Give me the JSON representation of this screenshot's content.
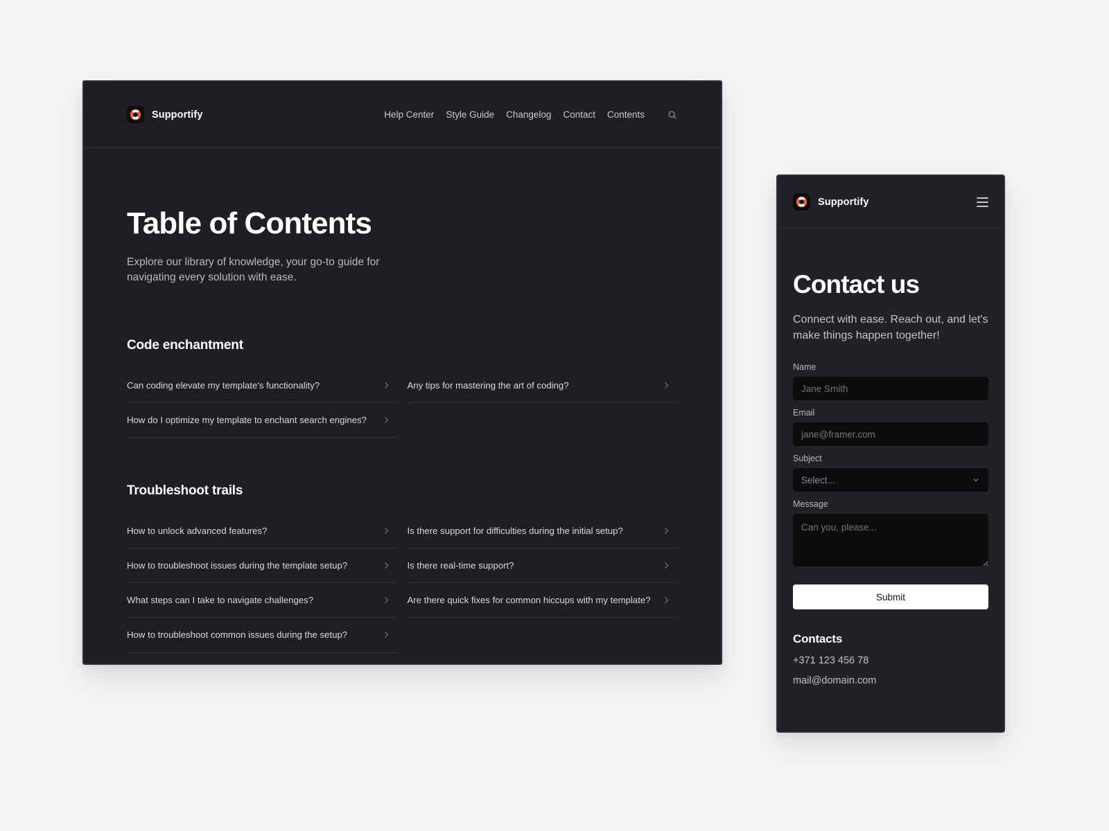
{
  "theme": {
    "page_bg": "#f4f4f6",
    "panel_bg": "#1e1e23",
    "panel_bg_mobile": "#212127",
    "field_bg": "#0c0c0f",
    "accent": "#e2603a",
    "text_primary": "#ffffff",
    "text_muted": "#b9b9c1",
    "divider": "#34343b"
  },
  "desktop": {
    "nav": {
      "brand": "Supportify",
      "logo_icon": "lifebuoy-icon",
      "links": [
        {
          "label": "Help Center"
        },
        {
          "label": "Style Guide"
        },
        {
          "label": "Changelog"
        },
        {
          "label": "Contact"
        },
        {
          "label": "Contents"
        }
      ],
      "search_icon": "search-icon"
    },
    "hero": {
      "title": "Table of Contents",
      "subtitle": "Explore our library of knowledge, your go-to guide for navigating every solution with ease."
    },
    "sections": [
      {
        "title": "Code enchantment",
        "left": [
          {
            "label": "Can coding elevate my template's functionality?"
          },
          {
            "label": "How do I optimize my template to enchant search engines?"
          }
        ],
        "right": [
          {
            "label": "Any tips for mastering the art of coding?"
          }
        ]
      },
      {
        "title": "Troubleshoot trails",
        "left": [
          {
            "label": "How to unlock advanced features?"
          },
          {
            "label": "How to troubleshoot issues during the template setup?"
          },
          {
            "label": "What steps can I take to navigate challenges?"
          },
          {
            "label": "How to troubleshoot common issues during the setup?"
          }
        ],
        "right": [
          {
            "label": "Is there support for difficulties during the initial setup?"
          },
          {
            "label": "Is there real-time support?"
          },
          {
            "label": "Are there quick fixes for common hiccups with my template?"
          }
        ]
      }
    ]
  },
  "mobile": {
    "nav": {
      "brand": "Supportify",
      "logo_icon": "lifebuoy-icon",
      "menu_icon": "hamburger-menu-icon"
    },
    "hero": {
      "title": "Contact us",
      "subtitle": "Connect with ease. Reach out, and let's make things happen together!"
    },
    "form": {
      "name": {
        "label": "Name",
        "placeholder": "Jane Smith",
        "value": ""
      },
      "email": {
        "label": "Email",
        "placeholder": "jane@framer.com",
        "value": ""
      },
      "subject": {
        "label": "Subject",
        "placeholder": "Select...",
        "value": "",
        "chevron_icon": "chevron-down-icon"
      },
      "message": {
        "label": "Message",
        "placeholder": "Can you, please...",
        "value": ""
      },
      "submit_label": "Submit"
    },
    "contacts": {
      "title": "Contacts",
      "phone": "+371 123 456 78",
      "email": "mail@domain.com"
    }
  }
}
